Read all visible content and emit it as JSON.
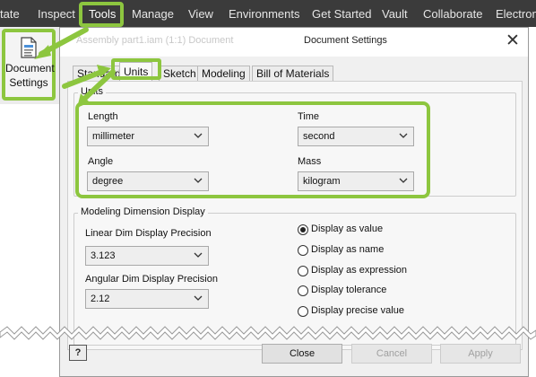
{
  "ribbon": {
    "tabs": [
      {
        "label": "tate",
        "active": false
      },
      {
        "label": "Inspect",
        "active": false
      },
      {
        "label": "Tools",
        "active": true
      },
      {
        "label": "Manage",
        "active": false
      },
      {
        "label": "View",
        "active": false
      },
      {
        "label": "Environments",
        "active": false
      },
      {
        "label": "Get Started",
        "active": false
      },
      {
        "label": "Vault",
        "active": false
      },
      {
        "label": "Collaborate",
        "active": false
      },
      {
        "label": "Electrom",
        "active": false
      }
    ],
    "document_settings_label": "Document Settings"
  },
  "dialog": {
    "title_faded": "Assembly part1.iam (1:1) Document",
    "title": "Document Settings",
    "tabs": [
      {
        "label": "Standard",
        "active": false
      },
      {
        "label": "Units",
        "active": true
      },
      {
        "label": "Sketch",
        "active": false
      },
      {
        "label": "Modeling",
        "active": false
      },
      {
        "label": "Bill of Materials",
        "active": false
      }
    ],
    "units_group": {
      "title": "Units",
      "length_label": "Length",
      "length_value": "millimeter",
      "time_label": "Time",
      "time_value": "second",
      "angle_label": "Angle",
      "angle_value": "degree",
      "mass_label": "Mass",
      "mass_value": "kilogram"
    },
    "dim_group": {
      "title": "Modeling Dimension Display",
      "linear_label": "Linear Dim Display Precision",
      "linear_value": "3.123",
      "angular_label": "Angular Dim Display Precision",
      "angular_value": "2.12",
      "options": [
        {
          "label": "Display as value",
          "selected": true
        },
        {
          "label": "Display as name",
          "selected": false
        },
        {
          "label": "Display as expression",
          "selected": false
        },
        {
          "label": "Display tolerance",
          "selected": false
        },
        {
          "label": "Display precise value",
          "selected": false
        }
      ]
    },
    "buttons": {
      "help": "?",
      "close": "Close",
      "cancel": "Cancel",
      "apply": "Apply"
    }
  },
  "colors": {
    "highlight": "#8dc63f",
    "ribbon_bg": "#3b3b3b",
    "dialog_bg": "#f0f0f0"
  }
}
